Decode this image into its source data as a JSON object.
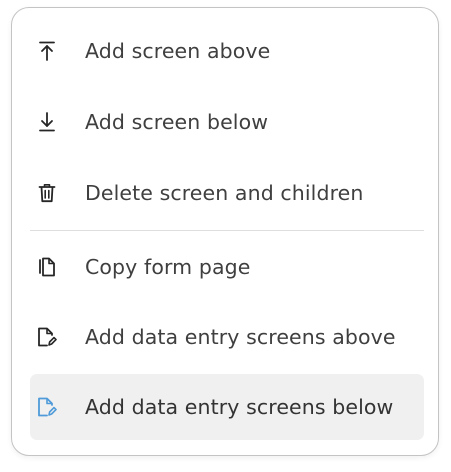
{
  "menu": {
    "items": [
      {
        "label": "Add screen above",
        "icon": "arrow-up-to-line-icon"
      },
      {
        "label": "Add screen below",
        "icon": "arrow-down-to-line-icon"
      },
      {
        "label": "Delete screen and children",
        "icon": "trash-icon"
      },
      {
        "label": "Copy form page",
        "icon": "copy-page-icon"
      },
      {
        "label": "Add data entry screens above",
        "icon": "file-edit-icon"
      },
      {
        "label": "Add data entry screens below",
        "icon": "file-edit-icon"
      }
    ],
    "active_index": 5,
    "colors": {
      "text": "#3f3f3f",
      "icon": "#262626",
      "active_icon": "#4f9bd9",
      "active_background": "#f1f0f0",
      "border": "#c4c4c4",
      "divider": "#dedede"
    }
  }
}
